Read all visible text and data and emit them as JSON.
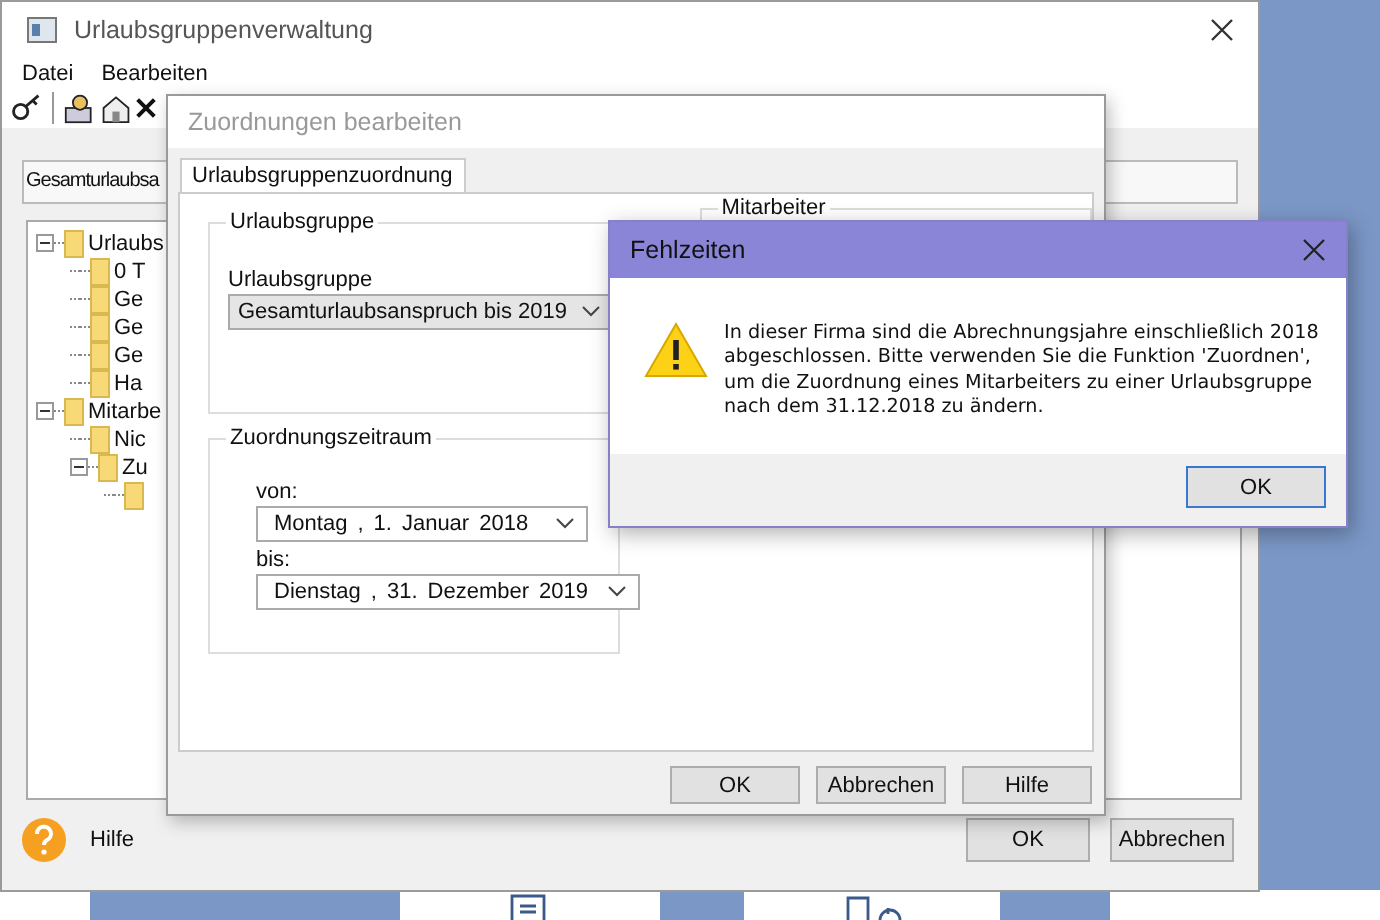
{
  "main_window": {
    "title": "Urlaubsgruppenverwaltung",
    "menu": [
      "Datei",
      "Bearbeiten"
    ],
    "filter_field": {
      "value": "Gesamturlaubsa"
    },
    "tree": [
      {
        "label": "Urlaubs",
        "expanded": true,
        "children": [
          {
            "label": "0 T"
          },
          {
            "label": "Ge"
          },
          {
            "label": "Ge"
          },
          {
            "label": "Ge"
          },
          {
            "label": "Ha"
          }
        ]
      },
      {
        "label": "Mitarbe",
        "expanded": true,
        "children": [
          {
            "label": "Nic"
          },
          {
            "label": "Zu",
            "expanded": true,
            "children": [
              {
                "kind": "folder"
              }
            ]
          }
        ]
      }
    ],
    "help": {
      "label": "Hilfe"
    },
    "buttons": [
      "OK",
      "Abbrechen"
    ]
  },
  "edit_dialog": {
    "title": "Zuordnungen bearbeiten",
    "tabs": [
      {
        "label": "Urlaubsgruppenzuordnung",
        "selected": true
      }
    ],
    "group_urlaubsgruppe": {
      "legend": "Urlaubsgruppe",
      "field_label": "Urlaubsgruppe",
      "value": "Gesamturlaubsanspruch bis 2019"
    },
    "group_mitarbeiter": {
      "legend": "Mitarbeiter"
    },
    "group_zeitraum": {
      "legend": "Zuordnungszeitraum",
      "from_label": "von:",
      "from": [
        "Montag",
        ",",
        "1.",
        "Januar",
        "2018"
      ],
      "to_label": "bis:",
      "to": [
        "Dienstag",
        ",",
        "31.",
        "Dezember",
        "2019"
      ]
    },
    "buttons": [
      "OK",
      "Abbrechen",
      "Hilfe"
    ]
  },
  "message_box": {
    "title": "Fehlzeiten",
    "kind": "warning",
    "lines": [
      "In dieser Firma sind die Abrechnungsjahre einschließlich 2018",
      "abgeschlossen. Bitte verwenden Sie die Funktion 'Zuordnen',",
      "um die Zuordnung eines Mitarbeiters zu einer Urlaubsgruppe",
      "nach dem 31.12.2018 zu ändern."
    ],
    "buttons": [
      "OK"
    ]
  }
}
